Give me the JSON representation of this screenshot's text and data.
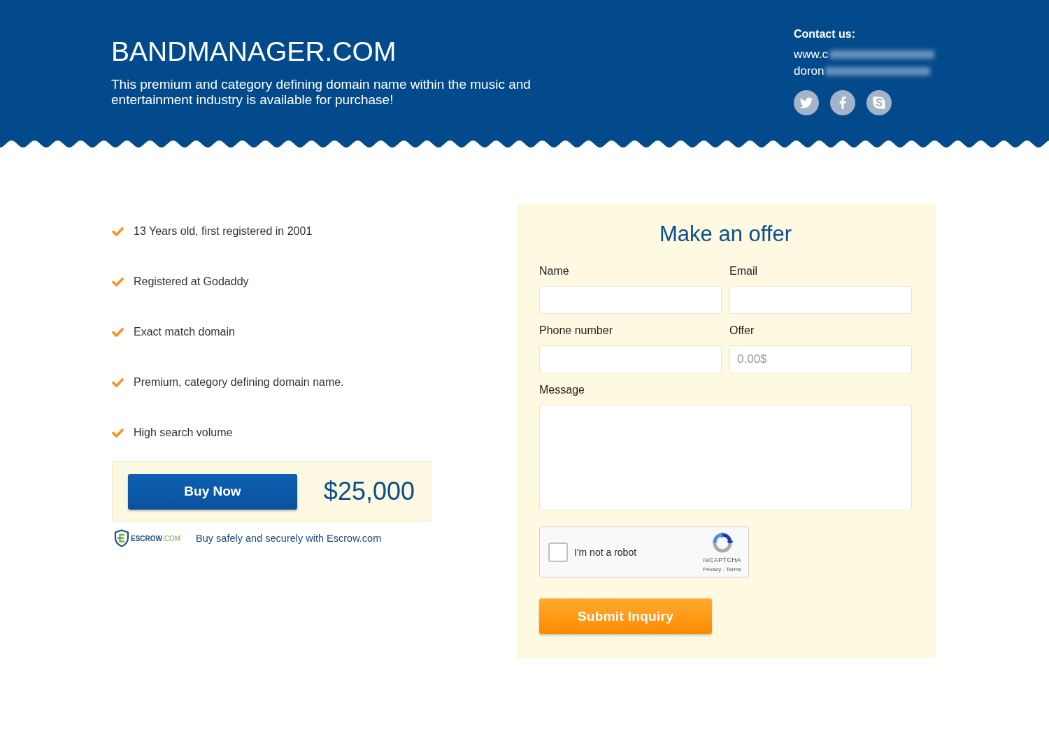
{
  "header": {
    "title": "BANDMANAGER.COM",
    "tagline": "This premium and category defining domain name within the music and entertainment industry is available for purchase!",
    "contact": {
      "heading": "Contact us:",
      "lines": [
        "www.c",
        "doron"
      ]
    }
  },
  "features": [
    "13 Years old, first registered in 2001",
    "Registered at Godaddy",
    "Exact match domain",
    "Premium, category defining domain name.",
    "High search volume"
  ],
  "purchase": {
    "button": "Buy Now",
    "price": "$25,000"
  },
  "escrow": {
    "logo_name": "ESCROW",
    "logo_suffix": ".COM",
    "note": "Buy safely and securely with Escrow.com"
  },
  "offer_form": {
    "title": "Make an offer",
    "fields": [
      {
        "kind": "input",
        "label": "Name"
      },
      {
        "kind": "input",
        "label": "Email"
      },
      {
        "kind": "input",
        "label": "Phone number"
      },
      {
        "kind": "input",
        "label": "Offer",
        "placeholder": "0.00$"
      },
      {
        "kind": "textarea",
        "label": "Message"
      }
    ],
    "captcha": {
      "label": "I'm not a robot",
      "checked": false,
      "brand": "reCAPTCHA",
      "legal": "Privacy - Terms"
    },
    "submit": "Submit Inquiry"
  }
}
